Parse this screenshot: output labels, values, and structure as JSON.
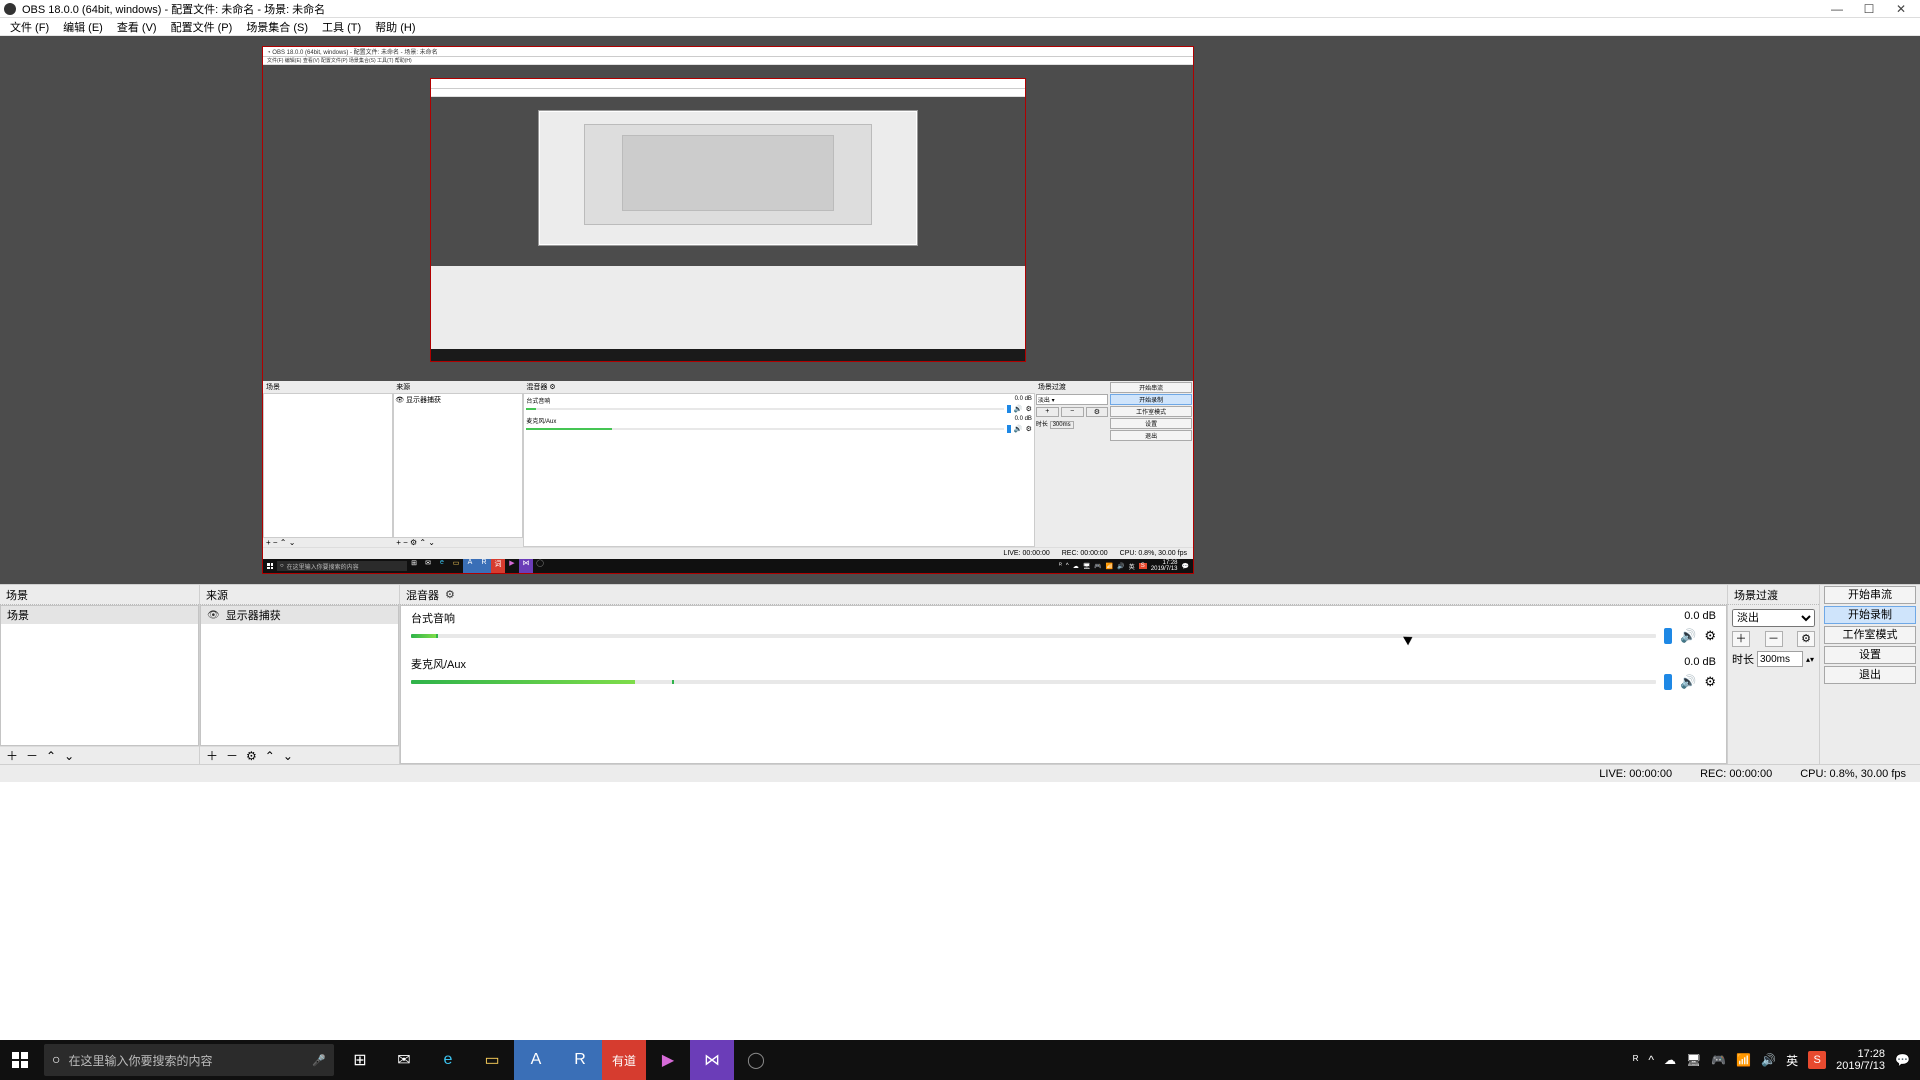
{
  "titlebar": {
    "title": "OBS 18.0.0 (64bit, windows) - 配置文件: 未命名 - 场景: 未命名"
  },
  "menu": {
    "file": "文件 (F)",
    "edit": "编辑 (E)",
    "view": "查看 (V)",
    "profile": "配置文件 (P)",
    "scene_collection": "场景集合 (S)",
    "tools": "工具 (T)",
    "help": "帮助 (H)"
  },
  "docks": {
    "scenes_title": "场景",
    "sources_title": "来源",
    "mixer_title": "混音器",
    "transitions_title": "场景过渡"
  },
  "scenes": {
    "items": [
      "场景"
    ]
  },
  "sources": {
    "items": [
      {
        "name": "显示器捕获"
      }
    ]
  },
  "mixer": {
    "channels": [
      {
        "name": "台式音响",
        "db": "0.0 dB",
        "level": 0.02
      },
      {
        "name": "麦克风/Aux",
        "db": "0.0 dB",
        "level": 0.18
      }
    ]
  },
  "transitions": {
    "selected": "淡出",
    "duration_label": "时长",
    "duration_value": "300ms"
  },
  "controls": {
    "start_stream": "开始串流",
    "start_record": "开始录制",
    "studio_mode": "工作室模式",
    "settings": "设置",
    "exit": "退出"
  },
  "status": {
    "live": "LIVE: 00:00:00",
    "rec": "REC: 00:00:00",
    "cpu": "CPU: 0.8%, 30.00 fps"
  },
  "taskbar": {
    "search_hint": "在这里输入你要搜索的内容",
    "ime": "英",
    "time": "17:28",
    "date": "2019/7/13"
  },
  "inner_status": {
    "live": "LIVE: 00:00:00",
    "rec": "REC: 00:00:00",
    "cpu": "CPU: 0.8%, 30.00 fps"
  }
}
